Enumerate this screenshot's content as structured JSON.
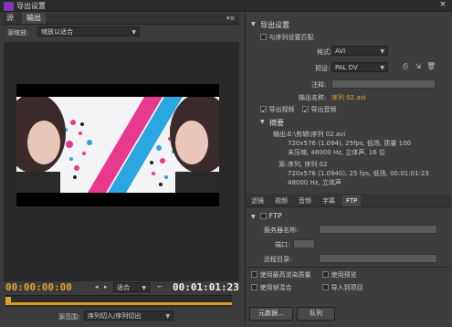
{
  "window": {
    "title": "导出设置",
    "close_glyph": "×"
  },
  "left": {
    "tabs": [
      "源",
      "输出"
    ],
    "panel_menu_glyph": "▾≡",
    "source_scaling_label": "源缩放:",
    "source_scaling_value": "缩放以适合",
    "timecode_start": "00:00:00:00",
    "fit_value": "适合",
    "timecode_end": "00:01:01:23",
    "range_label": "源范围:",
    "range_value": "序列切入/序列切出"
  },
  "right": {
    "export_settings_heading": "导出设置",
    "match_sequence_label": "与序列设置匹配",
    "format_label": "格式:",
    "format_value": "AVI",
    "preset_label": "预设:",
    "preset_value": "PAL DV",
    "comments_label": "注释:",
    "output_name_label": "输出名称:",
    "output_name_value": "序列 02.avi",
    "export_video_label": "导出视频",
    "export_audio_label": "导出音频",
    "summary_heading": "摘要",
    "output_label": "输出:",
    "output_line1": "E:\\剪辑\\序列 02.avi",
    "output_line2": "720x576 (1.094), 25fps, 低场, 质量 100",
    "output_line3": "未压缩, 48000 Hz, 立体声, 16 位",
    "source_label": "源:",
    "source_line1": "序列, 序列 02",
    "source_line2": "720x576 (1.0940), 25 fps, 低场, 00:01:01:23",
    "source_line3": "48000 Hz, 立体声",
    "tabs": [
      "滤镜",
      "视频",
      "音频",
      "字幕",
      "FTP"
    ],
    "ftp_heading": "FTP",
    "server_label": "服务器名称:",
    "port_label": "端口:",
    "remote_label": "远程目录:",
    "max_render_label": "使用最高渲染质量",
    "use_preview_label": "使用预览",
    "use_frame_blend_label": "使用帧混合",
    "import_project_label": "导入到项目",
    "metadata_button": "元数据...",
    "queue_button": "队列"
  }
}
